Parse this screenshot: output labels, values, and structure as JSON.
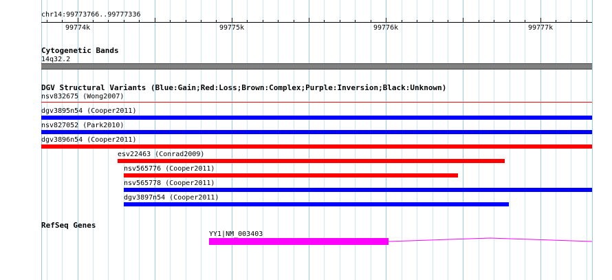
{
  "ruler": {
    "location": "chr14:99773766..99777336",
    "start": 99773766,
    "end": 99777336,
    "labels": [
      {
        "text": "99774k",
        "pos": 99774000
      },
      {
        "text": "99775k",
        "pos": 99775000
      },
      {
        "text": "99776k",
        "pos": 99776000
      },
      {
        "text": "99777k",
        "pos": 99777000
      }
    ]
  },
  "colors": {
    "grid_major": "#99cce6",
    "grid_minor": "#cce8f5",
    "band": "#808080",
    "gain": "#0000ff",
    "loss": "#ff0000",
    "gene": "#ff00ff"
  },
  "tracks": {
    "cytobands": {
      "title": "Cytogenetic Bands",
      "band_label": "14q32.2"
    },
    "dgv": {
      "title": "DGV Structural Variants (Blue:Gain;Red:Loss;Brown:Complex;Purple:Inversion;Black:Unknown)",
      "features": [
        {
          "label": "nsv832675 (Wong2007)",
          "type": "loss",
          "start": 99773766,
          "end": 99777336,
          "thin": true
        },
        {
          "label": "dgv3895n54 (Cooper2011)",
          "type": "gain",
          "start": 99773766,
          "end": 99777336
        },
        {
          "label": "nsv827052 (Park2010)",
          "type": "gain",
          "start": 99773766,
          "end": 99777336
        },
        {
          "label": "dgv3896n54 (Cooper2011)",
          "type": "loss",
          "start": 99773766,
          "end": 99777336
        },
        {
          "label": "esv22463 (Conrad2009)",
          "type": "loss",
          "start": 99774260,
          "end": 99776772
        },
        {
          "label": "nsv565776 (Cooper2011)",
          "type": "loss",
          "start": 99774300,
          "end": 99776465
        },
        {
          "label": "nsv565778 (Cooper2011)",
          "type": "gain",
          "start": 99774300,
          "end": 99777336
        },
        {
          "label": "dgv3897n54 (Cooper2011)",
          "type": "gain",
          "start": 99774300,
          "end": 99776795
        }
      ]
    },
    "refseq": {
      "title": "RefSeq Genes",
      "gene_label": "YY1|NM_003403",
      "exon_start": 99774854,
      "exon_end": 99776018,
      "intron_end": 99777336
    }
  }
}
